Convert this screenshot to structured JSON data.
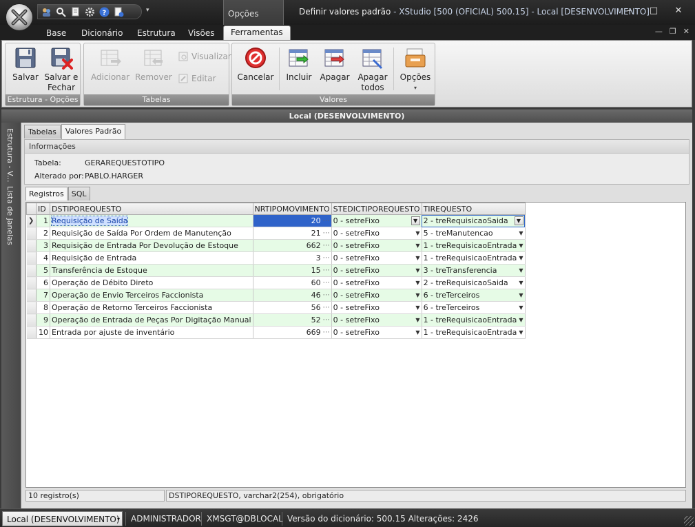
{
  "window": {
    "title_main": "Definir valores padrão",
    "title_rest": " - XStudio [500 (OFICIAL) 500.15] - Local [DESENVOLVIMENTO]",
    "context_tab": "Opções",
    "minimize": "–",
    "maximize": "□",
    "close": "✕"
  },
  "ribbon_tabs": [
    "Base",
    "Dicionário",
    "Estrutura",
    "Visões",
    "Ferramentas"
  ],
  "ribbon": {
    "group1": {
      "label": "Estrutura - Opções",
      "save": "Salvar",
      "save_close_1": "Salvar e",
      "save_close_2": "Fechar"
    },
    "group2": {
      "label": "Tabelas",
      "add": "Adicionar",
      "remove": "Remover",
      "view": "Visualizar",
      "edit": "Editar"
    },
    "group3": {
      "label": "Valores",
      "cancel": "Cancelar",
      "include": "Incluir",
      "delete": "Apagar",
      "delete_all_1": "Apagar",
      "delete_all_2": "todos",
      "options": "Opções"
    }
  },
  "doc_header": "Local (DESENVOLVIMENTO)",
  "side_strip": {
    "item1": "Estrutura - V...",
    "item2": "Lista de janelas"
  },
  "subtabs": [
    "Tabelas",
    "Valores Padrão"
  ],
  "info": {
    "title": "Informações",
    "table_label": "Tabela:",
    "table_value": "GERAREQUESTOTIPO",
    "changed_label": "Alterado por:",
    "changed_value": "PABLO.HARGER"
  },
  "grid_tabs": [
    "Registros",
    "SQL"
  ],
  "grid": {
    "columns": [
      "ID",
      "DSTIPOREQUESTO",
      "NRTIPOMOVIMENTO",
      "STEDICTIPOREQUESTO",
      "TIREQUESTO"
    ],
    "rows": [
      {
        "id": "1",
        "ds": "Requisição de Saída",
        "nr": "20",
        "st": "0 - setreFixo",
        "ti": "2 - treRequisicaoSaida"
      },
      {
        "id": "2",
        "ds": "Requisição de Saída Por Ordem de Manutenção",
        "nr": "21",
        "st": "0 - setreFixo",
        "ti": "5 - treManutencao"
      },
      {
        "id": "3",
        "ds": "Requisição de Entrada Por Devolução de Estoque",
        "nr": "662",
        "st": "0 - setreFixo",
        "ti": "1 - treRequisicaoEntrada"
      },
      {
        "id": "4",
        "ds": "Requisição de Entrada",
        "nr": "3",
        "st": "0 - setreFixo",
        "ti": "1 - treRequisicaoEntrada"
      },
      {
        "id": "5",
        "ds": "Transferência de Estoque",
        "nr": "15",
        "st": "0 - setreFixo",
        "ti": "3 - treTransferencia"
      },
      {
        "id": "6",
        "ds": "Operação de Débito Direto",
        "nr": "60",
        "st": "0 - setreFixo",
        "ti": "2 - treRequisicaoSaida"
      },
      {
        "id": "7",
        "ds": "Operação de Envio Terceiros Faccionista",
        "nr": "46",
        "st": "0 - setreFixo",
        "ti": "6 - treTerceiros"
      },
      {
        "id": "8",
        "ds": "Operação de Retorno Terceiros Faccionista",
        "nr": "56",
        "st": "0 - setreFixo",
        "ti": "6 - treTerceiros"
      },
      {
        "id": "9",
        "ds": "Operação de Entrada de Peças Por Digitação Manual",
        "nr": "52",
        "st": "0 - setreFixo",
        "ti": "1 - treRequisicaoEntrada"
      },
      {
        "id": "10",
        "ds": "Entrada por ajuste de inventário",
        "nr": "669",
        "st": "0 - setreFixo",
        "ti": "1 - treRequisicaoEntrada"
      }
    ]
  },
  "grid_status": {
    "count": "10 registro(s)",
    "field_info": "DSTIPOREQUESTO, varchar2(254), obrigatório"
  },
  "statusbar": {
    "connection": "Local (DESENVOLVIMENTO)",
    "user": "ADMINISTRADOR",
    "db": "XMSGT@DBLOCAL",
    "version": "Versão do dicionário: 500.15 Alterações: 2426"
  },
  "colors": {
    "selection": "#2f63c9",
    "alt_row": "#e6fbe6",
    "group_label": "#8a8a8a"
  }
}
